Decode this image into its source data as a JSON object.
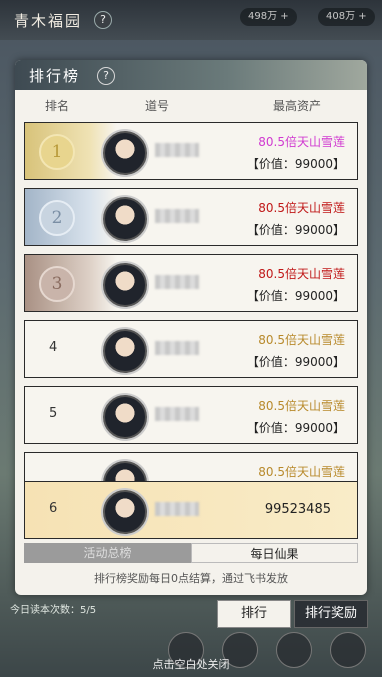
{
  "header": {
    "title": "青木福园",
    "help_icon": "?",
    "pill1": "498万 +",
    "pill2": "408万 +"
  },
  "panel": {
    "title": "排行榜",
    "help_icon": "?",
    "columns": {
      "rank": "排名",
      "name": "道号",
      "asset": "最高资产"
    }
  },
  "rows": [
    {
      "rank": "1",
      "asset_name": "80.5倍天山雪莲",
      "asset_value": "【价值：99000】",
      "asset_color": "#d03ad0"
    },
    {
      "rank": "2",
      "asset_name": "80.5倍天山雪莲",
      "asset_value": "【价值：99000】",
      "asset_color": "#c01818"
    },
    {
      "rank": "3",
      "asset_name": "80.5倍天山雪莲",
      "asset_value": "【价值：99000】",
      "asset_color": "#c01818"
    },
    {
      "rank": "4",
      "asset_name": "80.5倍天山雪莲",
      "asset_value": "【价值：99000】",
      "asset_color": "#b88a2c"
    },
    {
      "rank": "5",
      "asset_name": "80.5倍天山雪莲",
      "asset_value": "【价值：99000】",
      "asset_color": "#b88a2c"
    },
    {
      "rank": "",
      "asset_name": "80.5倍天山雪莲",
      "asset_value": "",
      "asset_color": "#b88a2c"
    }
  ],
  "my_row": {
    "rank": "6",
    "score": "99523485"
  },
  "tabs": {
    "activity": "活动总榜",
    "daily": "每日仙果"
  },
  "footnote": "排行榜奖励每日0点结算，通过飞书发放",
  "buttons": {
    "rank": "排行",
    "reward": "排行奖励"
  },
  "floor_text": "今日读本次数：5/5",
  "close_hint": "点击空白处关闭"
}
